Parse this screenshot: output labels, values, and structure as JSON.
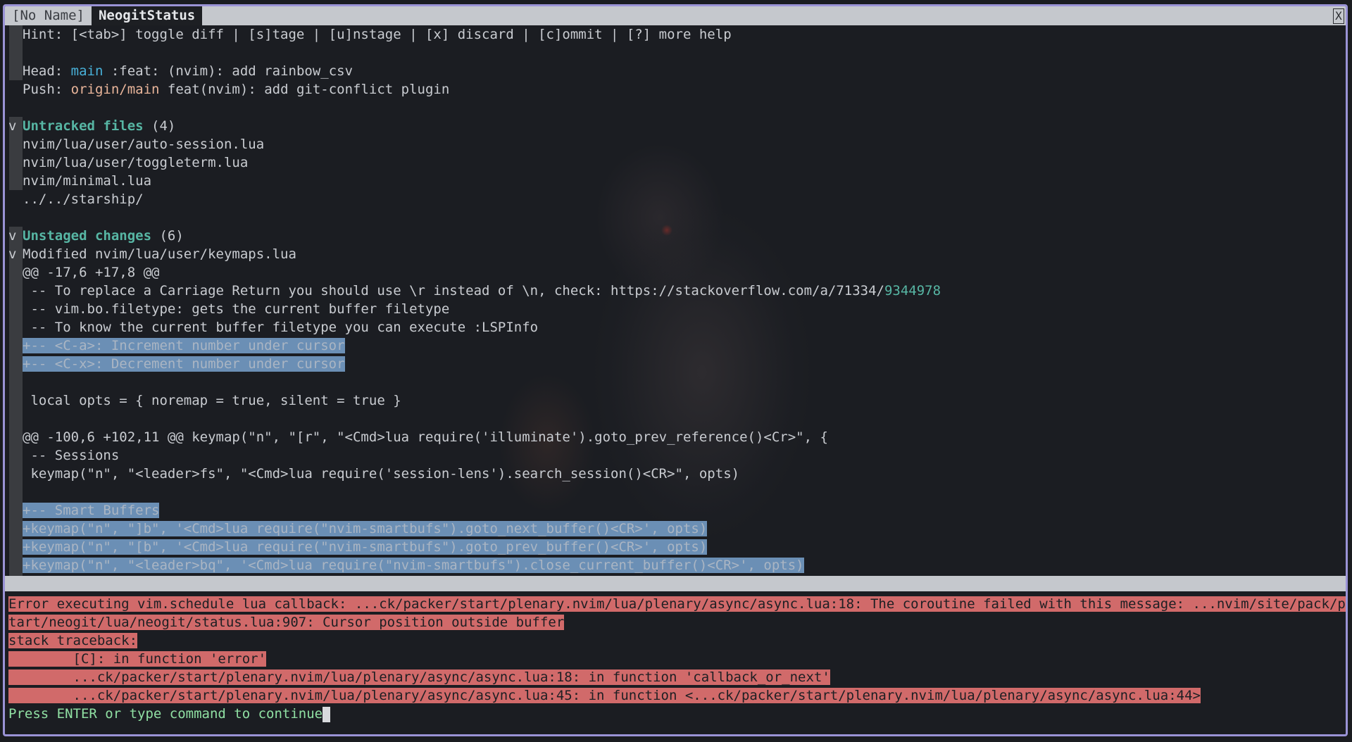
{
  "tabline": {
    "tab1": "[No Name]",
    "tab2": "NeogitStatus",
    "close": "X"
  },
  "status": {
    "hint": "Hint: [<tab>] toggle diff | [s]tage | [u]nstage | [x] discard | [c]ommit | [?] more help",
    "head_label": "Head: ",
    "head_branch": "main",
    "head_msg": " :feat: (nvim): add rainbow_csv",
    "push_label": "Push: ",
    "push_branch": "origin/main",
    "push_msg": " feat(nvim): add git-conflict plugin",
    "untracked_title": "Untracked files",
    "untracked_count": " (4)",
    "untracked": [
      "nvim/lua/user/auto-session.lua",
      "nvim/lua/user/toggleterm.lua",
      "nvim/minimal.lua",
      "../../starship/"
    ],
    "unstaged_title": "Unstaged changes",
    "unstaged_count": " (6)",
    "modified": "Modified nvim/lua/user/keymaps.lua",
    "fold_marker": "v",
    "hunk1": "@@ -17,6 +17,8 @@",
    "ctx1": " -- To replace a Carriage Return you should use \\r instead of \\n, check: https://stackoverflow.com/a/71334/",
    "ctx1_link": "9344978",
    "ctx2": " -- vim.bo.filetype: gets the current buffer filetype",
    "ctx3": " -- To know the current buffer filetype you can execute :LSPInfo",
    "add1": "+-- <C-a>: Increment number under cursor",
    "add2": "+-- <C-x>: Decrement number under cursor",
    "ctx4": " local opts = { noremap = true, silent = true }",
    "hunk2": "@@ -100,6 +102,11 @@ keymap(\"n\", \"[r\", \"<Cmd>lua require('illuminate').goto_prev_reference()<Cr>\", {",
    "ctx5": " -- Sessions",
    "ctx6": " keymap(\"n\", \"<leader>fs\", \"<Cmd>lua require('session-lens').search_session()<CR>\", opts)",
    "add3": "+-- Smart Buffers",
    "add4": "+keymap(\"n\", \"]b\", '<Cmd>lua require(\"nvim-smartbufs\").goto_next_buffer()<CR>', opts)",
    "add5": "+keymap(\"n\", \"[b\", '<Cmd>lua require(\"nvim-smartbufs\").goto_prev_buffer()<CR>', opts)",
    "add6": "+keymap(\"n\", \"<leader>bq\", '<Cmd>lua require(\"nvim-smartbufs\").close_current_buffer()<CR>', opts)"
  },
  "messages": {
    "err1": "Error executing vim.schedule lua callback: ...ck/packer/start/plenary.nvim/lua/plenary/async/async.lua:18: The coroutine failed with this message: ...nvim/site/pack/packer/s",
    "err2": "tart/neogit/lua/neogit/status.lua:907: Cursor position outside buffer",
    "err3": "stack traceback:",
    "err4": "        [C]: in function 'error'",
    "err5": "        ...ck/packer/start/plenary.nvim/lua/plenary/async/async.lua:18: in function 'callback_or_next'",
    "err6": "        ...ck/packer/start/plenary.nvim/lua/plenary/async/async.lua:45: in function <...ck/packer/start/plenary.nvim/lua/plenary/async/async.lua:44>",
    "prompt": "Press ENTER or type command to continue"
  }
}
